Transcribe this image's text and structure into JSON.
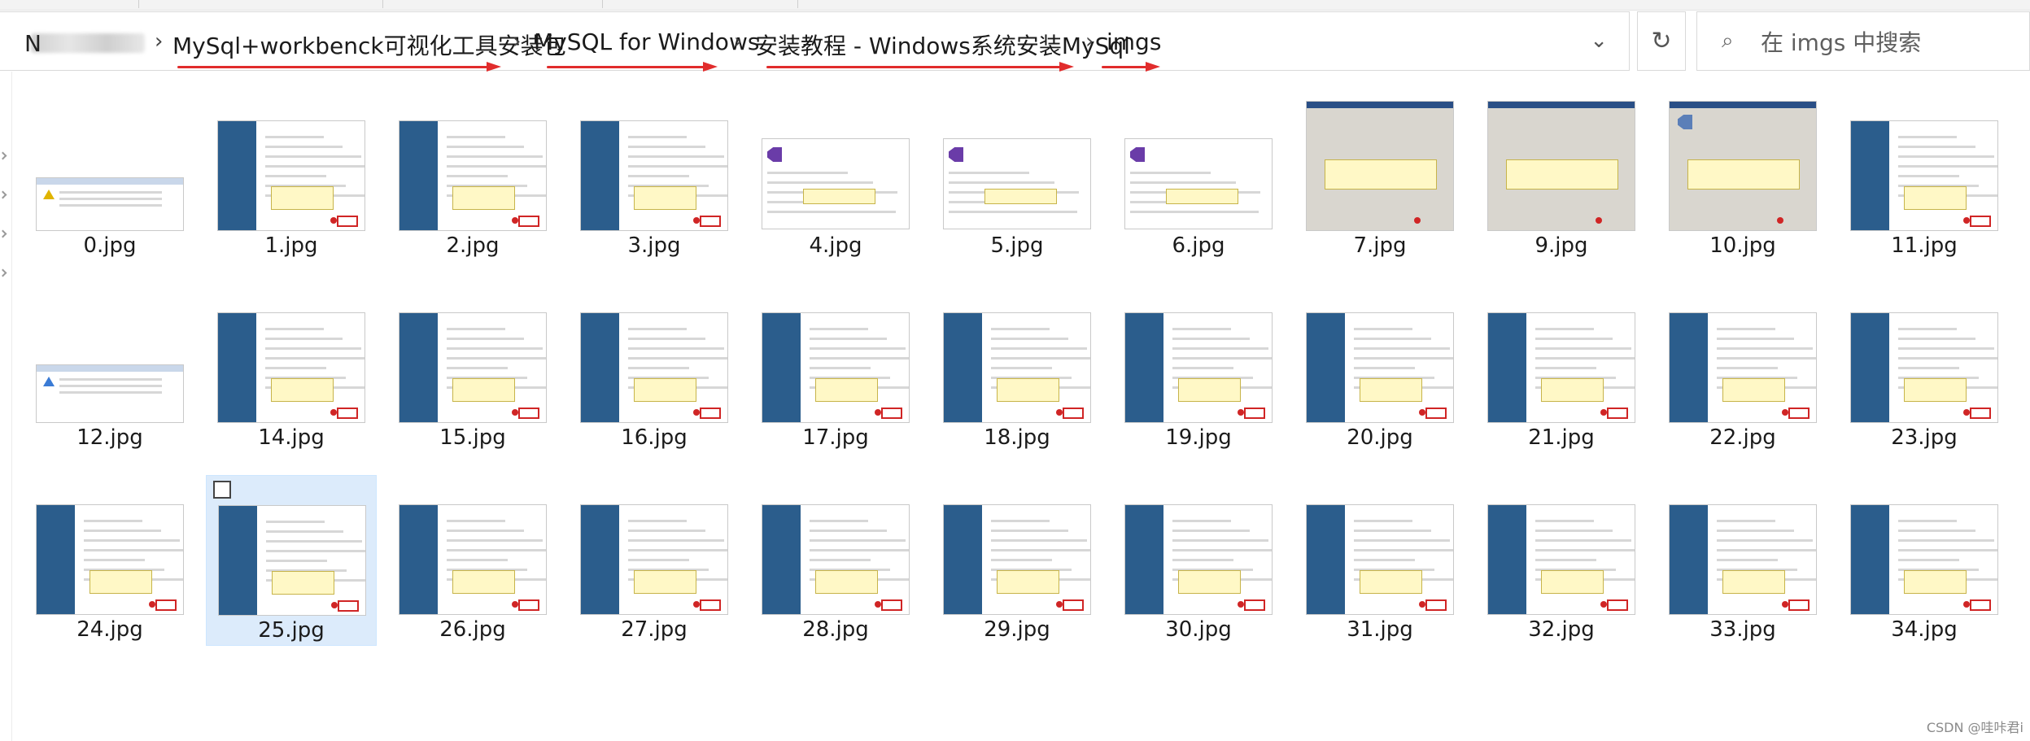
{
  "address_bar": {
    "first_crumb_visible": "N",
    "crumbs": [
      "MySql+workbenck可视化工具安装包",
      "MySQL for Windows",
      "安装教程 - Windows系统安装MySql",
      "imgs"
    ],
    "separator": "›"
  },
  "search": {
    "placeholder": "在 imgs 中搜索"
  },
  "icons": {
    "refresh": "refresh-icon",
    "dropdown": "chevron-down-icon",
    "search": "search-icon"
  },
  "files": [
    {
      "name": "0.jpg",
      "kind": "dialog-warn"
    },
    {
      "name": "1.jpg",
      "kind": "mysql"
    },
    {
      "name": "2.jpg",
      "kind": "mysql"
    },
    {
      "name": "3.jpg",
      "kind": "mysql"
    },
    {
      "name": "4.jpg",
      "kind": "vc"
    },
    {
      "name": "5.jpg",
      "kind": "vc"
    },
    {
      "name": "6.jpg",
      "kind": "vc"
    },
    {
      "name": "7.jpg",
      "kind": "gray"
    },
    {
      "name": "9.jpg",
      "kind": "gray"
    },
    {
      "name": "10.jpg",
      "kind": "gray-vs"
    },
    {
      "name": "11.jpg",
      "kind": "mysql"
    },
    {
      "name": "12.jpg",
      "kind": "dialog-small"
    },
    {
      "name": "14.jpg",
      "kind": "mysql"
    },
    {
      "name": "15.jpg",
      "kind": "mysql"
    },
    {
      "name": "16.jpg",
      "kind": "mysql"
    },
    {
      "name": "17.jpg",
      "kind": "mysql"
    },
    {
      "name": "18.jpg",
      "kind": "mysql"
    },
    {
      "name": "19.jpg",
      "kind": "mysql"
    },
    {
      "name": "20.jpg",
      "kind": "mysql"
    },
    {
      "name": "21.jpg",
      "kind": "mysql"
    },
    {
      "name": "22.jpg",
      "kind": "mysql"
    },
    {
      "name": "23.jpg",
      "kind": "mysql"
    },
    {
      "name": "24.jpg",
      "kind": "mysql"
    },
    {
      "name": "25.jpg",
      "kind": "mysql",
      "selected": true
    },
    {
      "name": "26.jpg",
      "kind": "mysql"
    },
    {
      "name": "27.jpg",
      "kind": "mysql"
    },
    {
      "name": "28.jpg",
      "kind": "mysql"
    },
    {
      "name": "29.jpg",
      "kind": "mysql"
    },
    {
      "name": "30.jpg",
      "kind": "mysql"
    },
    {
      "name": "31.jpg",
      "kind": "mysql"
    },
    {
      "name": "32.jpg",
      "kind": "mysql"
    },
    {
      "name": "33.jpg",
      "kind": "mysql"
    },
    {
      "name": "34.jpg",
      "kind": "mysql"
    }
  ],
  "colors": {
    "selection": "#dcebfb",
    "annotation": "#e12c2c",
    "mysql_sidebar": "#2b5d8c"
  },
  "watermark": "CSDN @哇咔君i"
}
